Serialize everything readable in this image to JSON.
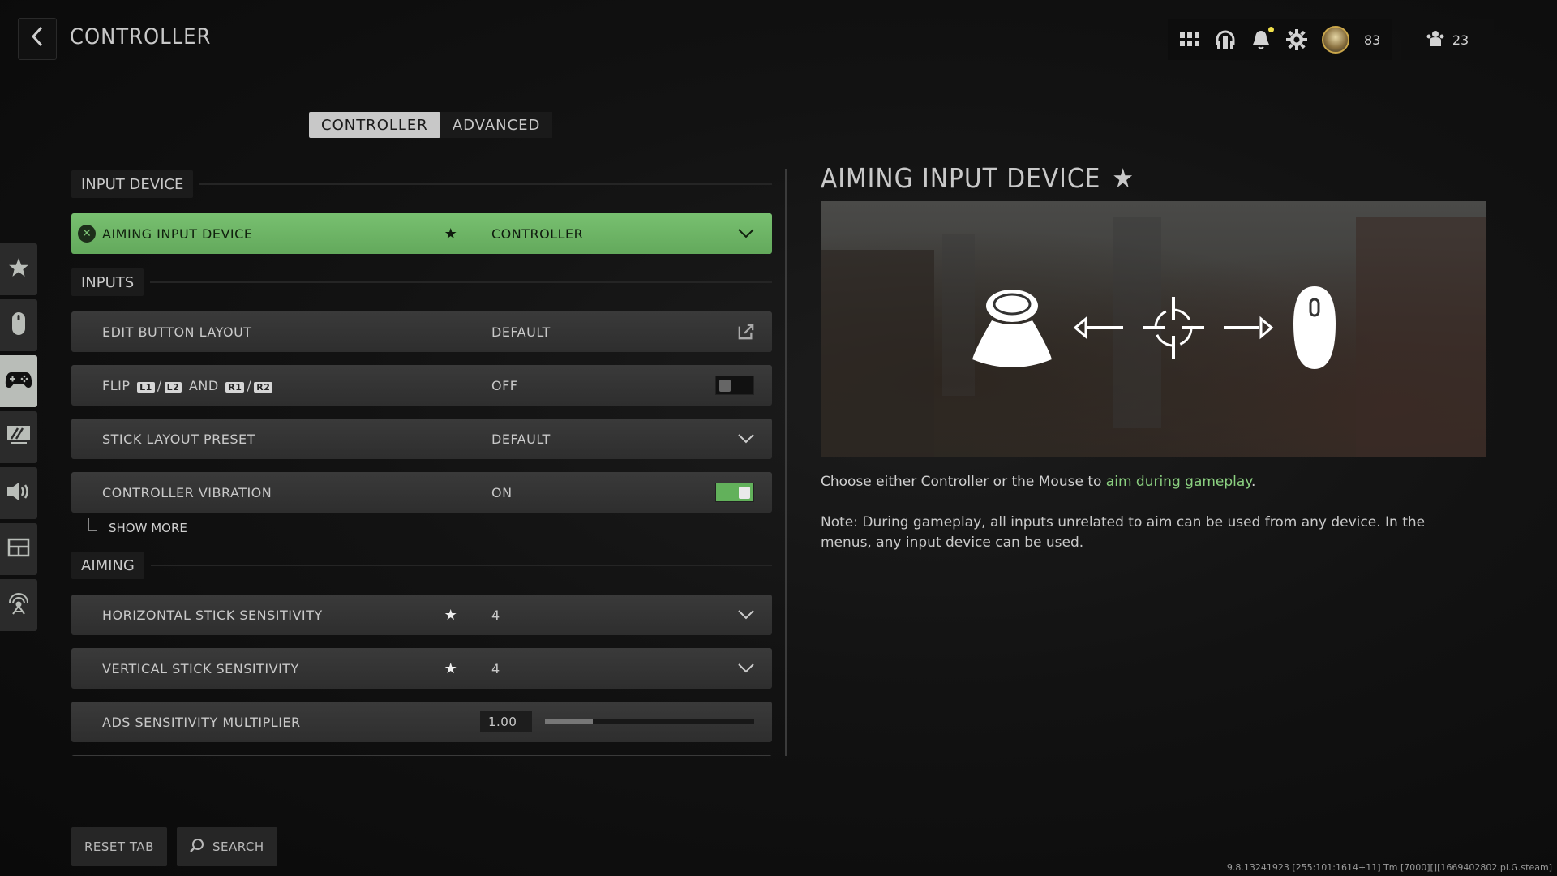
{
  "header": {
    "title": "CONTROLLER",
    "back_icon": "chevron-left-icon",
    "icons": [
      "grid-menu-icon",
      "headset-icon",
      "bell-icon",
      "gear-icon"
    ],
    "level": "83",
    "friends_count": "23"
  },
  "tabs": [
    {
      "label": "CONTROLLER",
      "active": true
    },
    {
      "label": "ADVANCED",
      "active": false
    }
  ],
  "sidebar": {
    "items": [
      {
        "icon": "star-icon",
        "active": false
      },
      {
        "icon": "mouse-icon",
        "active": false
      },
      {
        "icon": "gamepad-icon",
        "active": true
      },
      {
        "icon": "monitor-icon",
        "active": false
      },
      {
        "icon": "speaker-icon",
        "active": false
      },
      {
        "icon": "interface-icon",
        "active": false
      },
      {
        "icon": "network-icon",
        "active": false
      }
    ]
  },
  "sections": {
    "input_device": "INPUT DEVICE",
    "inputs": "INPUTS",
    "aiming": "AIMING"
  },
  "rows": {
    "aiming_input_device": {
      "label": "AIMING INPUT DEVICE",
      "value": "CONTROLLER",
      "starred": true
    },
    "edit_button_layout": {
      "label": "EDIT BUTTON LAYOUT",
      "value": "DEFAULT"
    },
    "flip": {
      "label_prefix": "FLIP",
      "l1": "L1",
      "l2": "L2",
      "and": "AND",
      "r1": "R1",
      "r2": "R2",
      "sep": "/",
      "value": "OFF",
      "toggle_on": false
    },
    "stick_layout_preset": {
      "label": "STICK LAYOUT PRESET",
      "value": "DEFAULT"
    },
    "controller_vibration": {
      "label": "CONTROLLER VIBRATION",
      "value": "ON",
      "toggle_on": true
    },
    "show_more": "SHOW MORE",
    "horizontal_stick_sensitivity": {
      "label": "HORIZONTAL STICK SENSITIVITY",
      "value": "4",
      "starred": true
    },
    "vertical_stick_sensitivity": {
      "label": "VERTICAL STICK SENSITIVITY",
      "value": "4",
      "starred": true
    },
    "ads_sensitivity_multiplier": {
      "label": "ADS SENSITIVITY MULTIPLIER",
      "value": "1.00",
      "slider_fraction": 0.23
    }
  },
  "detail": {
    "title": "AIMING INPUT DEVICE",
    "star": "★",
    "desc_prefix": "Choose either Controller or the Mouse to ",
    "desc_highlight": "aim during gameplay",
    "desc_suffix": ".",
    "note": "Note: During gameplay, all inputs unrelated to aim can be used from any device. In the menus, any input device can be used."
  },
  "bottom": {
    "reset_tab": "RESET TAB",
    "search": "SEARCH"
  },
  "version": "9.8.13241923 [255:101:1614+11] Tm [7000][][1669402802.pl.G.steam]",
  "colors": {
    "accent_green": "#6ab862",
    "highlight_text": "#8bd080",
    "notification_dot": "#f0e04a"
  }
}
